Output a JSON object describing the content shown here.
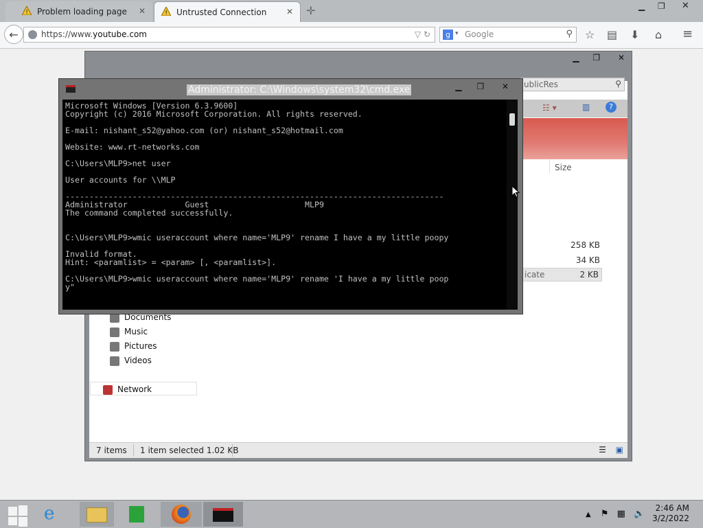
{
  "browser": {
    "tabs": [
      {
        "label": "Problem loading page",
        "active": false
      },
      {
        "label": "Untrusted Connection",
        "active": true
      }
    ],
    "url_prefix": "https://www.",
    "url_domain": "youtube.com",
    "search_placeholder": "Google",
    "window_buttons": [
      "minimize",
      "restore",
      "close"
    ]
  },
  "explorer": {
    "search_fragment": "ublicRes",
    "size_header": "Size",
    "sizes": [
      "258 KB",
      "34 KB"
    ],
    "selected_row": {
      "name_fragment": "icate",
      "size": "2 KB"
    },
    "nav_items": [
      "Documents",
      "Music",
      "Pictures",
      "Videos"
    ],
    "network_label": "Network",
    "status": {
      "items": "7 items",
      "selection": "1 item selected  1.02 KB"
    }
  },
  "cmd": {
    "title": "Administrator: C:\\Windows\\system32\\cmd.exe",
    "output": "Microsoft Windows [Version 6.3.9600]\nCopyright (c) 2016 Microsoft Corporation. All rights reserved.\n\nE-mail: nishant_s52@yahoo.com (or) nishant_s52@hotmail.com\n\nWebsite: www.rt-networks.com\n\nC:\\Users\\MLP9>net user\n\nUser accounts for \\\\MLP\n\n-------------------------------------------------------------------------------\nAdministrator            Guest                    MLP9\nThe command completed successfully.\n\n\nC:\\Users\\MLP9>wmic useraccount where name='MLP9' rename I have a my little poopy\n\nInvalid format.\nHint: <paramlist> = <param> [, <paramlist>].\n\nC:\\Users\\MLP9>wmic useraccount where name='MLP9' rename 'I have a my little poop\ny\""
  },
  "taskbar": {
    "time": "2:46 AM",
    "date": "3/2/2022"
  },
  "colors": {
    "console_bg": "#000000",
    "console_text": "#c0c0c0",
    "ribbon_red": "#d85a50",
    "taskbar": "#b4b6b9"
  }
}
